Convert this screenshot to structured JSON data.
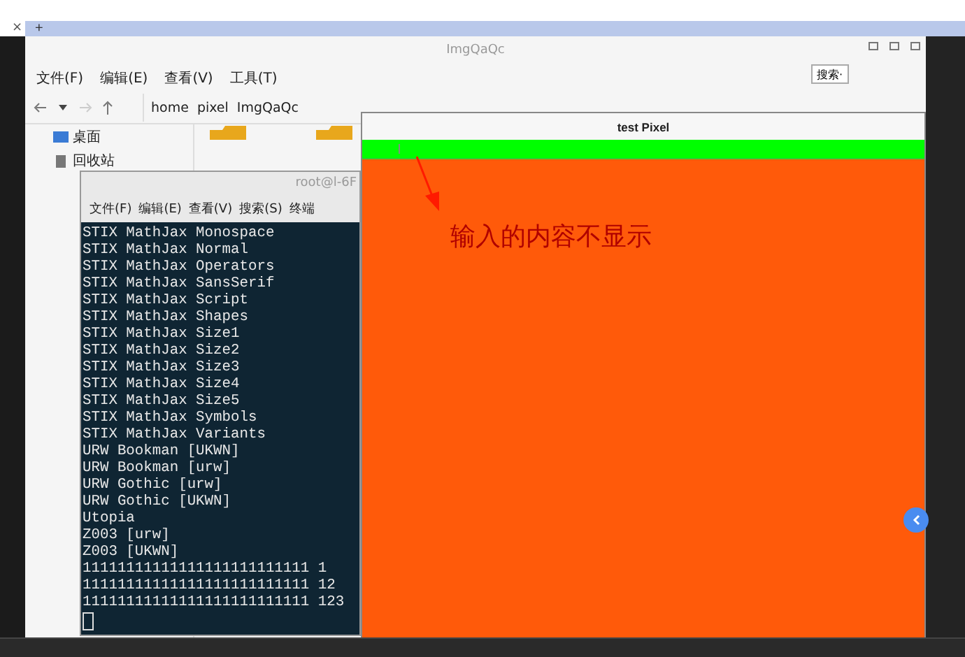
{
  "browser_tabs": {
    "close": "×",
    "new_tab": "+"
  },
  "file_manager": {
    "title": "ImgQaQc",
    "menu": [
      "文件(F)",
      "编辑(E)",
      "查看(V)",
      "工具(T)"
    ],
    "breadcrumb": [
      "home",
      "pixel",
      "ImgQaQc"
    ],
    "search_button": "搜索·",
    "sidebar": [
      {
        "label": "桌面"
      },
      {
        "label": "回收站"
      }
    ]
  },
  "terminal": {
    "title": "root@l-6F",
    "menu": [
      "文件(F)",
      "编辑(E)",
      "查看(V)",
      "搜索(S)",
      "终端"
    ],
    "lines": [
      "STIX MathJax Monospace",
      "STIX MathJax Normal",
      "STIX MathJax Operators",
      "STIX MathJax SansSerif",
      "STIX MathJax Script",
      "STIX MathJax Shapes",
      "STIX MathJax Size1",
      "STIX MathJax Size2",
      "STIX MathJax Size3",
      "STIX MathJax Size4",
      "STIX MathJax Size5",
      "STIX MathJax Symbols",
      "STIX MathJax Variants",
      "URW Bookman [UKWN]",
      "URW Bookman [urw]",
      "URW Gothic [urw]",
      "URW Gothic [UKWN]",
      "Utopia",
      "Z003 [urw]",
      "Z003 [UKWN]",
      "11111111111111111111111111 1",
      "11111111111111111111111111 12",
      "11111111111111111111111111 123"
    ]
  },
  "test_window": {
    "title": "test Pixel",
    "annotation": "输入的内容不显示"
  }
}
